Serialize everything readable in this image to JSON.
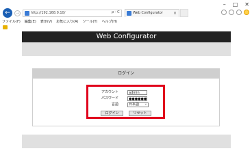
{
  "window": {
    "minimize": "–",
    "maximize": "□",
    "close": "✕"
  },
  "browser": {
    "back_glyph": "←",
    "forward_glyph": "→",
    "url": "http://192.168.0.10/",
    "address_tools": "ρ - C",
    "tab_title": "Web Configurator",
    "tab_close": "×"
  },
  "menu": {
    "items": [
      "ファイル(F)",
      "編集(E)",
      "表示(V)",
      "お気に入り(A)",
      "ツール(T)",
      "ヘルプ(H)"
    ]
  },
  "page": {
    "header_title": "Web Configurator",
    "login_title": "ログイン",
    "account_label": "アカウント",
    "account_value": "admin",
    "password_label": "パスワード",
    "password_value": "●●●●●●",
    "language_label": "言語",
    "language_value": "日本語",
    "login_button": "ログイン",
    "reset_button": "リセット"
  },
  "colors": {
    "header_bg": "#222222",
    "highlight_border": "#e0001b",
    "band_bg": "#e0e0e0"
  }
}
